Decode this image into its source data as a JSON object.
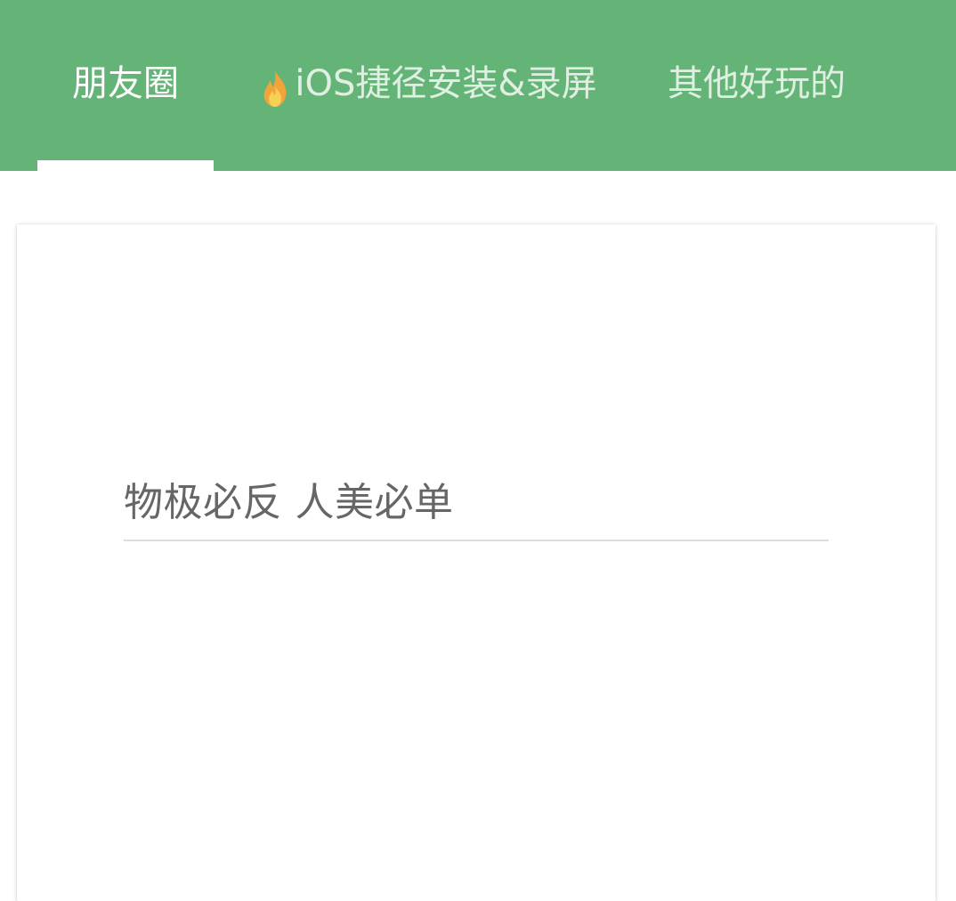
{
  "tabs": [
    {
      "label": "朋友圈",
      "active": true
    },
    {
      "label": "iOS捷径安装&录屏",
      "icon": "fire-icon",
      "active": false
    },
    {
      "label": "其他好玩的",
      "active": false
    }
  ],
  "card": {
    "text_field_value": "物极必反 人美必单"
  },
  "colors": {
    "topbar": "#63b476",
    "active_tab_text": "#ffffff",
    "inactive_tab_text": "#dff0e2",
    "field_text": "#666666",
    "field_underline": "#dcdcdc"
  }
}
